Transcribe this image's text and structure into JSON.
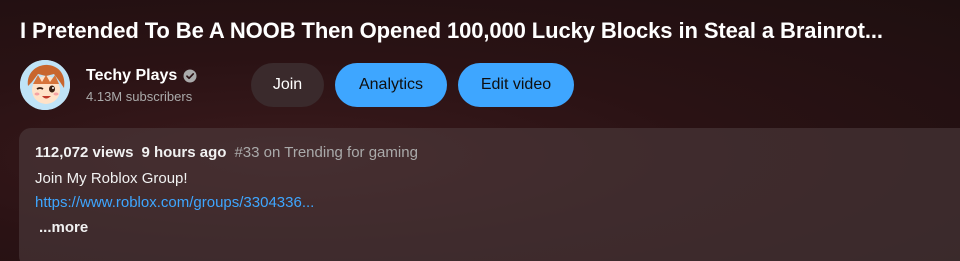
{
  "video": {
    "title": "I Pretended To Be A NOOB Then Opened 100,000 Lucky Blocks in Steal a Brainrot..."
  },
  "channel": {
    "name": "Techy Plays",
    "subscribers": "4.13M subscribers",
    "verified_icon": "verified-check-icon",
    "avatar_icon": "channel-avatar"
  },
  "actions": {
    "join_label": "Join",
    "analytics_label": "Analytics",
    "edit_label": "Edit video"
  },
  "description": {
    "views": "112,072 views",
    "time": "9 hours ago",
    "trending": "#33 on Trending for gaming",
    "line1": "Join My Roblox Group!",
    "link": "https://www.roblox.com/groups/3304336...",
    "more_label": "...more"
  },
  "colors": {
    "accent": "#3ea6ff",
    "background": "#2a1214",
    "secondary_text": "#aaaaaa"
  }
}
